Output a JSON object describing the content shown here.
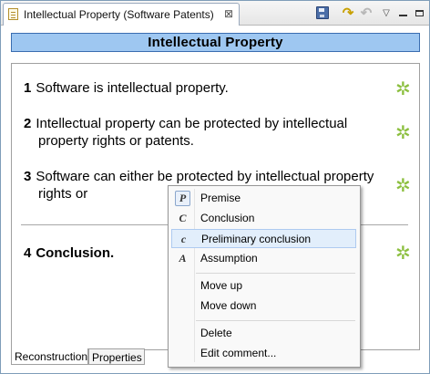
{
  "editor": {
    "tab_title": "Intellectual Property (Software Patents)",
    "close_glyph": "⊠",
    "header_title": "Intellectual Property"
  },
  "toolbar": {
    "icons": [
      "save-icon",
      "redo-icon",
      "undo-icon",
      "view-menu-icon",
      "minimize-icon",
      "maximize-icon"
    ],
    "redo_glyph": "↷",
    "undo_glyph": "↶",
    "menu_glyph": "▽"
  },
  "statements": [
    {
      "number": "1",
      "text": "Software is intellectual property."
    },
    {
      "number": "2",
      "text": "Intellectual property can be protected by intellectual property rights or patents."
    },
    {
      "number": "3",
      "text": "Software can either be protected by intellectual property rights or"
    },
    {
      "number": "4",
      "text": "Conclusion."
    }
  ],
  "star_glyph": "✲",
  "star_color": "#8cbf3f",
  "view_tabs": [
    "Reconstruction",
    "Properties"
  ],
  "context_menu": {
    "items": [
      {
        "icon_letter": "P",
        "label": "Premise"
      },
      {
        "icon_letter": "C",
        "label": "Conclusion"
      },
      {
        "icon_letter": "c",
        "label": "Preliminary conclusion",
        "highlighted": true
      },
      {
        "icon_letter": "A",
        "label": "Assumption"
      },
      {
        "label": "Move up"
      },
      {
        "label": "Move down"
      },
      {
        "label": "Delete"
      },
      {
        "label": "Edit comment..."
      }
    ]
  },
  "colors": {
    "header_background": "#9ec7f1",
    "menu_highlight": "#e2eefb"
  }
}
